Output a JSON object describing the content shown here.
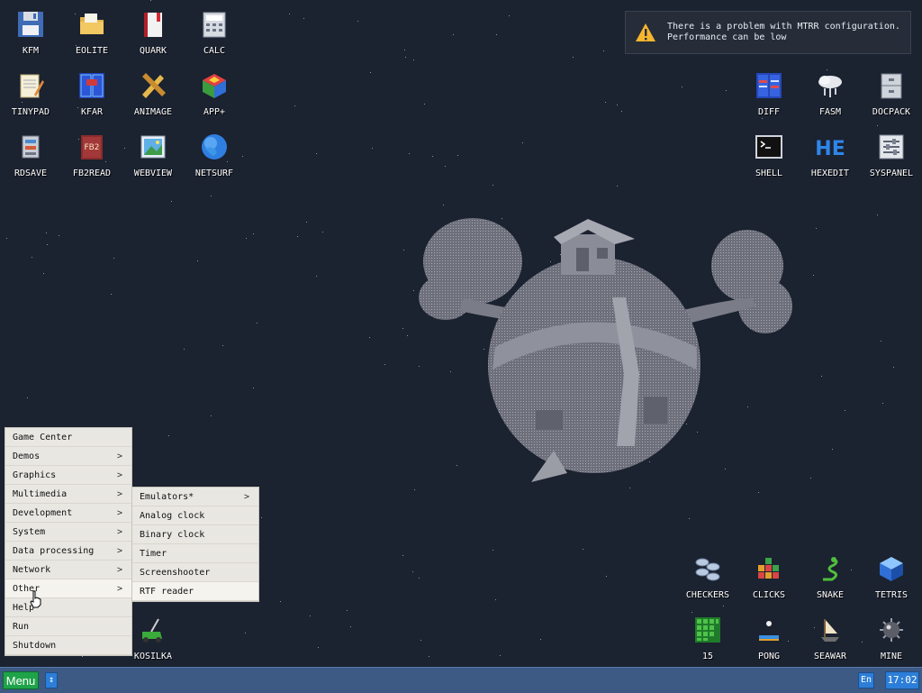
{
  "desktop": {
    "icons_left": [
      {
        "label": "KFM",
        "icon": "floppy-disk-icon"
      },
      {
        "label": "EOLITE",
        "icon": "folder-icon"
      },
      {
        "label": "QUARK",
        "icon": "notebook-icon"
      },
      {
        "label": "CALC",
        "icon": "calculator-icon"
      },
      {
        "label": "TINYPAD",
        "icon": "notepad-icon"
      },
      {
        "label": "KFAR",
        "icon": "panels-icon"
      },
      {
        "label": "ANIMAGE",
        "icon": "pencil-ruler-icon"
      },
      {
        "label": "APP+",
        "icon": "cube-icon"
      },
      {
        "label": "RDSAVE",
        "icon": "ram-disk-icon"
      },
      {
        "label": "FB2READ",
        "icon": "book-icon"
      },
      {
        "label": "WEBVIEW",
        "icon": "picture-icon"
      },
      {
        "label": "NETSURF",
        "icon": "globe-icon"
      }
    ],
    "icons_right_top": [
      {
        "label": "DIFF",
        "icon": "diff-icon"
      },
      {
        "label": "FASM",
        "icon": "cloud-rain-icon"
      },
      {
        "label": "DOCPACK",
        "icon": "cabinet-icon"
      },
      {
        "label": "SHELL",
        "icon": "terminal-icon"
      },
      {
        "label": "HEXEDIT",
        "icon": "he-letters-icon"
      },
      {
        "label": "SYSPANEL",
        "icon": "sliders-icon"
      }
    ],
    "icons_games": [
      {
        "label": "CHECKERS",
        "icon": "checkers-icon"
      },
      {
        "label": "CLICKS",
        "icon": "blocks-icon"
      },
      {
        "label": "SNAKE",
        "icon": "snake-icon"
      },
      {
        "label": "TETRIS",
        "icon": "tetris-cube-icon"
      },
      {
        "label": "15",
        "icon": "grid-15-icon"
      },
      {
        "label": "PONG",
        "icon": "pong-icon"
      },
      {
        "label": "SEAWAR",
        "icon": "seawar-icon"
      },
      {
        "label": "MINE",
        "icon": "mine-icon"
      }
    ],
    "kosilka": {
      "label": "KOSILKA",
      "icon": "lawnmower-icon"
    }
  },
  "notification": {
    "line1": "There is a problem with MTRR configuration.",
    "line2": "Performance can be low",
    "icon": "warning-icon"
  },
  "main_menu": {
    "items": [
      {
        "label": "Game Center",
        "sub": false
      },
      {
        "label": "Demos",
        "sub": true
      },
      {
        "label": "Graphics",
        "sub": true
      },
      {
        "label": "Multimedia",
        "sub": true
      },
      {
        "label": "Development",
        "sub": true
      },
      {
        "label": "System",
        "sub": true
      },
      {
        "label": "Data processing",
        "sub": true
      },
      {
        "label": "Network",
        "sub": true
      },
      {
        "label": "Other",
        "sub": true
      },
      {
        "label": "Help",
        "sub": false
      },
      {
        "label": "Run",
        "sub": false
      },
      {
        "label": "Shutdown",
        "sub": false
      }
    ],
    "arrow": ">"
  },
  "sub_menu": {
    "items": [
      {
        "label": "Emulators*",
        "sub": true
      },
      {
        "label": "Analog clock",
        "sub": false
      },
      {
        "label": "Binary clock",
        "sub": false
      },
      {
        "label": "Timer",
        "sub": false
      },
      {
        "label": "Screenshooter",
        "sub": false
      },
      {
        "label": "RTF reader",
        "sub": false
      }
    ]
  },
  "taskbar": {
    "menu_label": "Menu",
    "up_glyph": "↕",
    "lang": "En",
    "time": "17:02"
  },
  "colors": {
    "desktop_bg": "#1b2230",
    "taskbar": "#3d5a85",
    "menu_button": "#1fa34a",
    "accent_blue": "#2c7ed8"
  }
}
